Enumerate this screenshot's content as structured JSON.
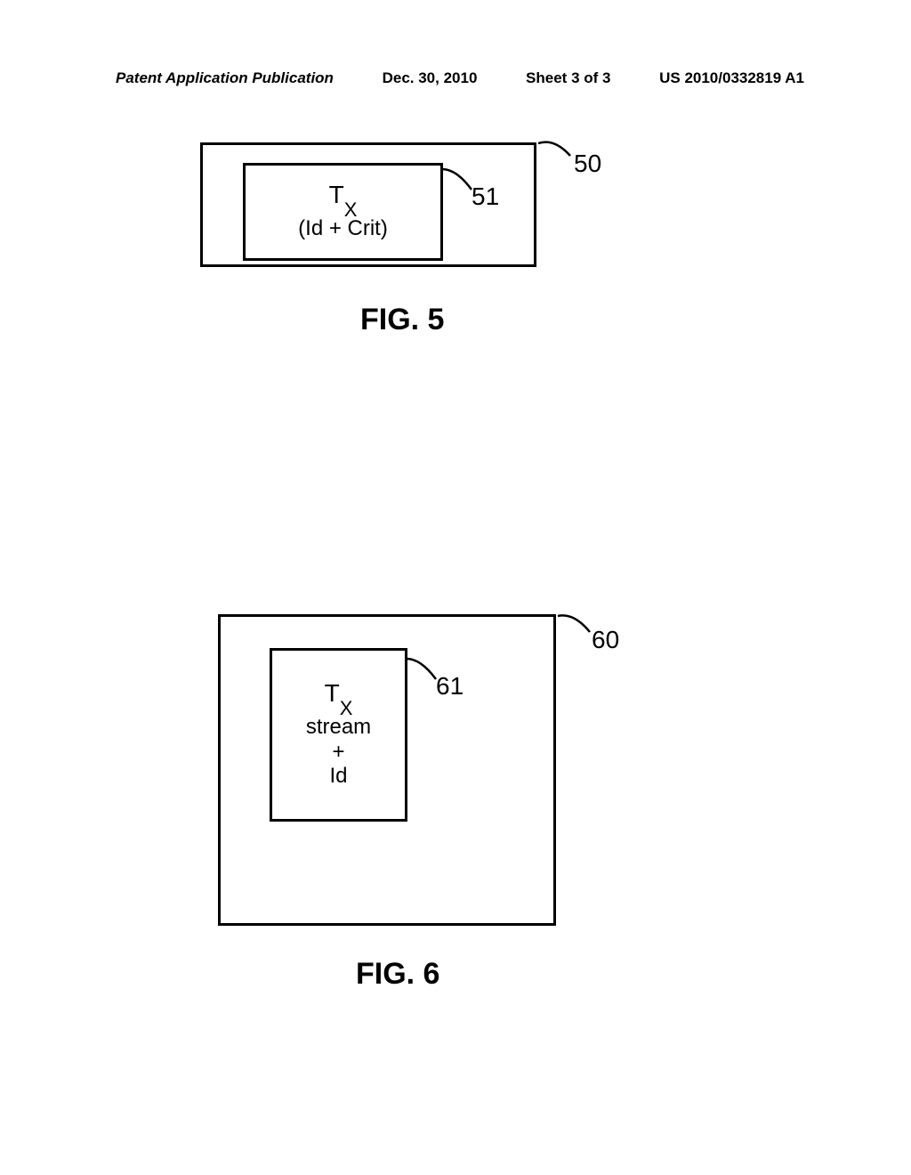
{
  "header": {
    "publication_type": "Patent Application Publication",
    "date": "Dec. 30, 2010",
    "sheet": "Sheet 3 of 3",
    "pub_number": "US 2010/0332819 A1"
  },
  "fig5": {
    "caption": "FIG. 5",
    "outer_ref": "50",
    "inner_ref": "51",
    "inner_line1_main": "T",
    "inner_line1_sub": "X",
    "inner_line2": "(Id + Crit)"
  },
  "fig6": {
    "caption": "FIG. 6",
    "outer_ref": "60",
    "inner_ref": "61",
    "inner_line1_main": "T",
    "inner_line1_sub": "X",
    "inner_line2": "stream",
    "inner_line3": "+",
    "inner_line4": "Id"
  }
}
